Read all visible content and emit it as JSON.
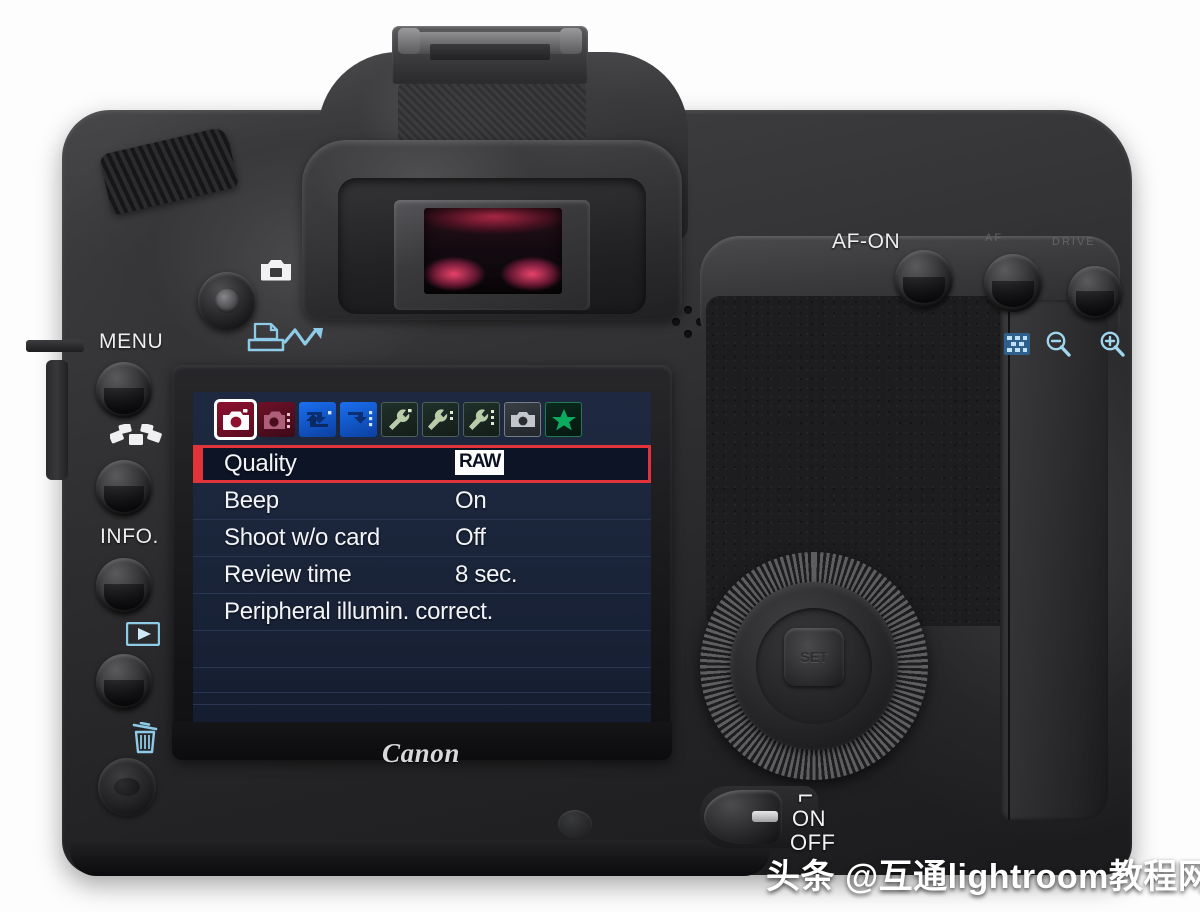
{
  "device": {
    "brand": "Canon",
    "watermark": "头条 @互通lightroom教程网"
  },
  "controls": {
    "menu_label": "MENU",
    "picture_style_icon": "picture-style-icon",
    "info_label": "INFO.",
    "playback_icon": "playback-icon",
    "erase_icon": "trash-icon",
    "light_sensor_icon": "light-sensor-icon",
    "direct_print_icon": "direct-print-icon",
    "direct_transfer_icon": "direct-transfer-icon",
    "live_view_icon": "live-view-camera-icon",
    "afon_label": "AF-ON",
    "af_point_icon": "af-point-selection-icon",
    "zoom_out_icon": "magnify-minus-icon",
    "zoom_in_icon": "magnify-plus-icon",
    "set_label": "SET",
    "power": {
      "movie_mark": "⌐",
      "on_label": "ON",
      "off_label": "OFF"
    },
    "top_engraving_left": "AF",
    "top_engraving_right": "DRIVE"
  },
  "lcd": {
    "tabs": [
      {
        "name": "shooting-1",
        "icon": "camera-red-icon",
        "selected": true
      },
      {
        "name": "shooting-2",
        "icon": "camera-red-dots-icon",
        "selected": false
      },
      {
        "name": "playback-1",
        "icon": "playback-blue-icon",
        "selected": false
      },
      {
        "name": "playback-2",
        "icon": "playback-blue-dots-icon",
        "selected": false
      },
      {
        "name": "setup-1",
        "icon": "wrench-icon",
        "selected": false
      },
      {
        "name": "setup-2",
        "icon": "wrench-dots-icon",
        "selected": false
      },
      {
        "name": "setup-3",
        "icon": "wrench-dots3-icon",
        "selected": false
      },
      {
        "name": "custom-functions",
        "icon": "camera-gray-icon",
        "selected": false
      },
      {
        "name": "my-menu",
        "icon": "green-star-icon",
        "selected": false
      }
    ],
    "rows": [
      {
        "label": "Quality",
        "value": "RAW",
        "highlighted": true,
        "boxed_value": true
      },
      {
        "label": "Beep",
        "value": "On",
        "highlighted": false,
        "boxed_value": false
      },
      {
        "label": "Shoot w/o card",
        "value": "Off",
        "highlighted": false,
        "boxed_value": false
      },
      {
        "label": "Review time",
        "value": "8 sec.",
        "highlighted": false,
        "boxed_value": false
      },
      {
        "label": "Peripheral illumin. correct.",
        "value": "",
        "highlighted": false,
        "boxed_value": false
      },
      {
        "label": "",
        "value": "",
        "highlighted": false,
        "boxed_value": false
      },
      {
        "label": "",
        "value": "",
        "highlighted": false,
        "boxed_value": false
      }
    ]
  },
  "colors": {
    "lcd_background": "#1e2941",
    "highlight_red": "#e2323a",
    "row_separator": "#2a3552",
    "text_white": "#f2f4f8",
    "icon_blue": "#8ecbe8",
    "body_dark": "#2e2e30",
    "tab_red": "#b4203c",
    "tab_blue": "#1464e6",
    "tab_green": "#0c9c5c"
  }
}
